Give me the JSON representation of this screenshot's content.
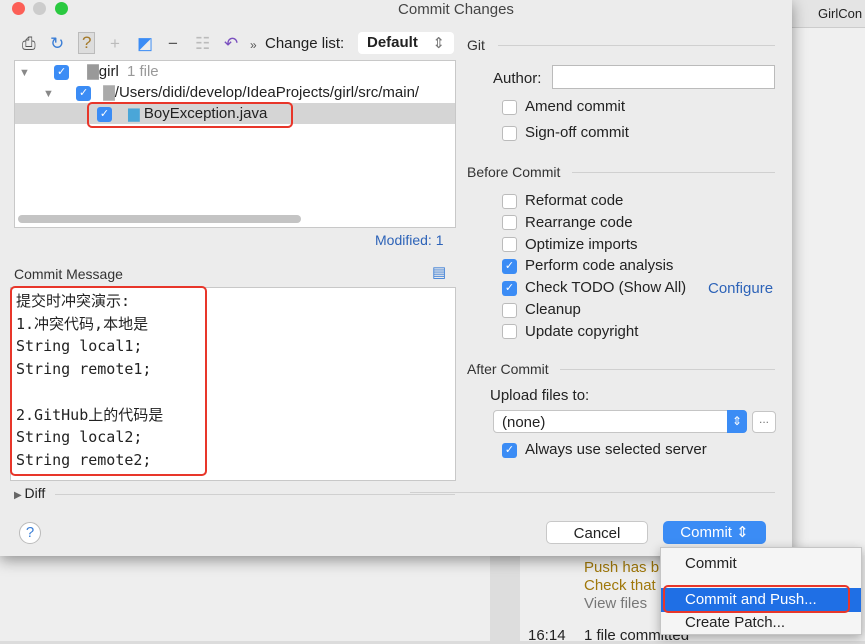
{
  "window": {
    "title": "Commit Changes"
  },
  "background": {
    "tab": "GirlCon",
    "log_lines": [
      "Push has b",
      "Check that",
      "View files"
    ],
    "log_time": "16:14",
    "log_text": "1 file committed"
  },
  "toolbar": {
    "change_list_label": "Change list:",
    "change_list_value": "Default"
  },
  "tree": {
    "root": "girl",
    "root_count": "1 file",
    "path": "/Users/didi/develop/IdeaProjects/girl/src/main/",
    "file": "BoyException.java"
  },
  "modified": "Modified: 1",
  "commit_message": {
    "label": "Commit Message",
    "text": "提交时冲突演示:\n1.冲突代码,本地是\nString local1;\nString remote1;\n\n2.GitHub上的代码是\nString local2;\nString remote2;"
  },
  "diff_label": "Diff",
  "git": {
    "label": "Git",
    "author_label": "Author:",
    "author_value": "",
    "amend": "Amend commit",
    "signoff": "Sign-off commit"
  },
  "before_commit": {
    "label": "Before Commit",
    "options": [
      {
        "label": "Reformat code",
        "checked": false
      },
      {
        "label": "Rearrange code",
        "checked": false
      },
      {
        "label": "Optimize imports",
        "checked": false
      },
      {
        "label": "Perform code analysis",
        "checked": true
      },
      {
        "label": "Check TODO (Show All)",
        "checked": true
      },
      {
        "label": "Cleanup",
        "checked": false
      },
      {
        "label": "Update copyright",
        "checked": false
      }
    ],
    "configure_link": "Configure"
  },
  "after_commit": {
    "label": "After Commit",
    "upload_label": "Upload files to:",
    "upload_value": "(none)",
    "browse": "...",
    "always_use": "Always use selected server"
  },
  "buttons": {
    "help": "?",
    "cancel": "Cancel",
    "commit": "Commit"
  },
  "menu": {
    "items": [
      "Commit",
      "Commit and Push...",
      "Create Patch..."
    ],
    "selected": "Commit and Push..."
  },
  "colors": {
    "accent": "#3b8cf5",
    "highlight": "#e8362a"
  }
}
